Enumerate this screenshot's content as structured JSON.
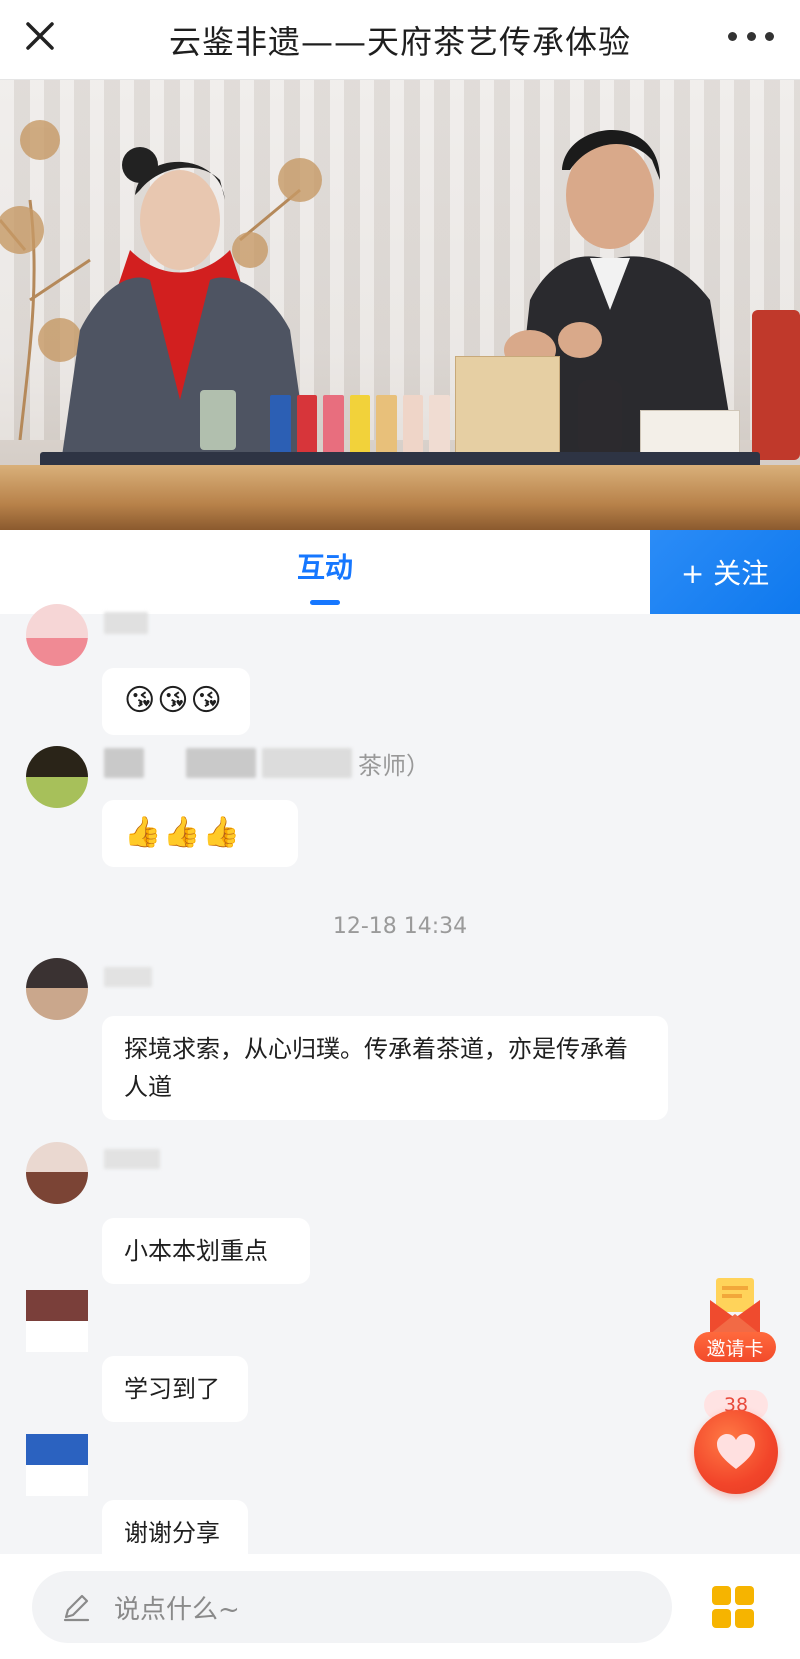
{
  "header": {
    "title": "云鉴非遗——天府茶艺传承体验"
  },
  "video": {
    "description_icon": "live-video-frame"
  },
  "tabbar": {
    "interact_tab": "互动",
    "follow_button": "+ 关注"
  },
  "chat": {
    "messages": [
      {
        "emoji": "😘😘😘"
      },
      {
        "name_suffix": "茶师）",
        "emoji": "👍👍👍"
      },
      {
        "text": "探境求索，从心归璞。传承着茶道，亦是传承着人道"
      },
      {
        "text": "小本本划重点"
      },
      {
        "text": "学习到了"
      },
      {
        "text": "谢谢分享"
      }
    ],
    "timestamp": "12-18 14:34"
  },
  "floating": {
    "invite_label": "邀请卡",
    "like_count": "38"
  },
  "bottom": {
    "input_placeholder": "说点什么~"
  },
  "colors": {
    "accent": "#1677ff",
    "like": "#f2452a",
    "invite": "#f24a2a",
    "grid_icon": "#f6b400"
  }
}
